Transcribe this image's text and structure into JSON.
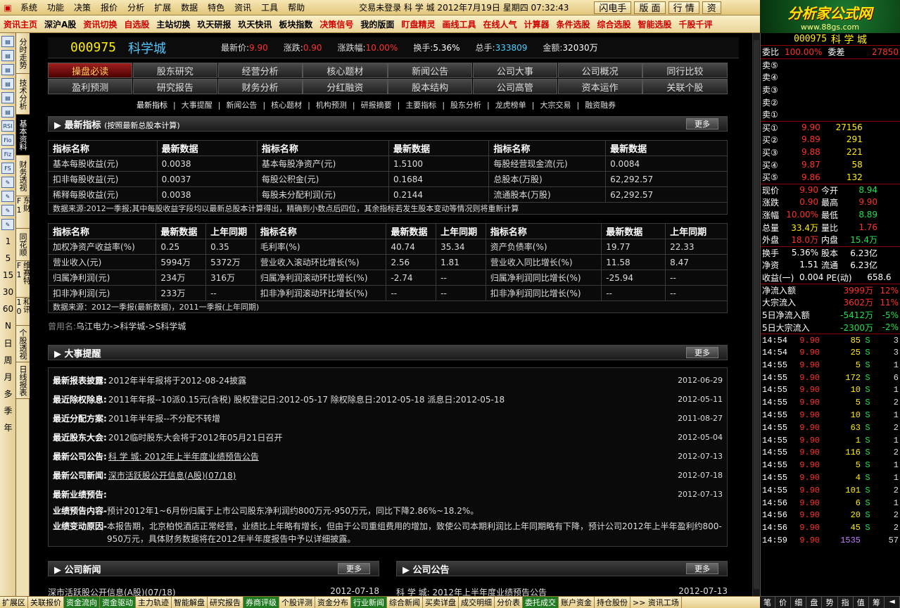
{
  "menu": {
    "items": [
      "系统",
      "功能",
      "决策",
      "报价",
      "分析",
      "扩展",
      "数据",
      "特色",
      "资讯",
      "工具",
      "帮助"
    ],
    "status": "交易未登录  科 学 城  2012年7月19日 星期四  07:32:43",
    "buttons": [
      "闪电手",
      "版 面",
      "行 情",
      "资"
    ]
  },
  "brand": {
    "title": "分析家公式网",
    "url": "www.88gs.com"
  },
  "toolbar": {
    "items": [
      {
        "label": "资讯主页",
        "color": "#d00000"
      },
      {
        "label": "深沪A股",
        "color": "#000000"
      },
      {
        "label": "资讯切换",
        "color": "#d00000"
      },
      {
        "label": "自选股",
        "color": "#d00000"
      },
      {
        "label": "主站切换",
        "color": "#000000"
      },
      {
        "label": "玖天研报",
        "color": "#000000"
      },
      {
        "label": "玖天快讯",
        "color": "#000000"
      },
      {
        "label": "板块指数",
        "color": "#000000"
      },
      {
        "label": "决策信号",
        "color": "#d00000"
      },
      {
        "label": "我的版面",
        "color": "#000000"
      },
      {
        "label": "盯盘精灵",
        "color": "#d00000"
      },
      {
        "label": "画线工具",
        "color": "#d00000"
      },
      {
        "label": "在线人气",
        "color": "#d00000"
      },
      {
        "label": "计算器",
        "color": "#d00000"
      },
      {
        "label": "条件选股",
        "color": "#d00000"
      },
      {
        "label": "综合选股",
        "color": "#d00000"
      },
      {
        "label": "智能选股",
        "color": "#d00000"
      },
      {
        "label": "千股千评",
        "color": "#d00000"
      }
    ]
  },
  "left_icons": [
    "RSI",
    "Fio",
    "Fiz",
    "FS"
  ],
  "left_periods": [
    "1",
    "5",
    "15",
    "30",
    "60",
    "N",
    "日",
    "周",
    "月",
    "多",
    "季",
    "年"
  ],
  "vtabs": [
    "分时走势",
    "技术分析",
    "基本资料",
    "财务透视",
    "东财F1",
    "同花顺",
    "维赛特F1",
    "和讯10",
    "个股透视",
    "日线报表"
  ],
  "header": {
    "code": "000975",
    "name": "科学城",
    "quotes": [
      {
        "label": "最新价:",
        "value": "9.90",
        "color": "red"
      },
      {
        "label": "涨跌:",
        "value": "0.90",
        "color": "red"
      },
      {
        "label": "涨跌幅:",
        "value": "10.00%",
        "color": "red"
      },
      {
        "label": "换手:",
        "value": "5.36%",
        "color": "white"
      },
      {
        "label": "总手:",
        "value": "333809",
        "color": "cyan"
      },
      {
        "label": "金额:",
        "value": "32030万",
        "color": "white"
      }
    ]
  },
  "nav": {
    "row1": [
      "操盘必读",
      "股东研究",
      "经营分析",
      "核心题材",
      "新闻公告",
      "公司大事",
      "公司概况",
      "同行比较"
    ],
    "row2": [
      "盈利预测",
      "研究报告",
      "财务分析",
      "分红融资",
      "股本结构",
      "公司高管",
      "资本运作",
      "关联个股"
    ],
    "active": "操盘必读"
  },
  "subnav": [
    "最新指标",
    "大事提醒",
    "新闻公告",
    "核心题材",
    "机构预测",
    "研报摘要",
    "主要指标",
    "股东分析",
    "龙虎榜单",
    "大宗交易",
    "融资融券"
  ],
  "latest": {
    "title": "最新指标",
    "subtitle": "(按照最新总股本计算)",
    "more": "更多",
    "headers": [
      "指标名称",
      "最新数据",
      "指标名称",
      "最新数据",
      "指标名称",
      "最新数据"
    ],
    "rows": [
      [
        "基本每股收益(元)",
        "0.0038",
        "基本每股净资产(元)",
        "1.5100",
        "每股经营现金流(元)",
        "0.0084"
      ],
      [
        "扣非每股收益(元)",
        "0.0037",
        "每股公积金(元)",
        "0.1684",
        "总股本(万股)",
        "62,292.57"
      ],
      [
        "稀释每股收益(元)",
        "0.0038",
        "每股未分配利润(元)",
        "0.2144",
        "流通股本(万股)",
        "62,292.57"
      ]
    ],
    "note": "数据来源:2012一季报;其中每股收益字段均以最新总股本计算得出，精确到小数点后四位，其余指标若发生股本变动等情况则将重新计算"
  },
  "growth": {
    "headers": [
      "指标名称",
      "最新数据",
      "上年同期",
      "指标名称",
      "最新数据",
      "上年同期",
      "指标名称",
      "最新数据",
      "上年同期"
    ],
    "rows": [
      [
        "加权净资产收益率(%)",
        "0.25",
        "0.35",
        "毛利率(%)",
        "40.74",
        "35.34",
        "资产负债率(%)",
        "19.77",
        "22.33"
      ],
      [
        "营业收入(元)",
        "5994万",
        "5372万",
        "营业收入滚动环比增长(%)",
        "2.56",
        "1.81",
        "营业收入同比增长(%)",
        "11.58",
        "8.47"
      ],
      [
        "归属净利润(元)",
        "234万",
        "316万",
        "归属净利润滚动环比增长(%)",
        "-2.74",
        "--",
        "归属净利润同比增长(%)",
        "-25.94",
        "--"
      ],
      [
        "扣非净利润(元)",
        "233万",
        "--",
        "扣非净利润滚动环比增长(%)",
        "--",
        "--",
        "扣非净利润同比增长(%)",
        "--",
        "--"
      ]
    ],
    "note": "数据来源：2012一季报(最新数据)，2011一季报(上年同期)"
  },
  "oldname": {
    "label": "曾用名:",
    "value": "乌江电力->科学城->S科学城"
  },
  "events": {
    "title": "大事提醒",
    "more": "更多",
    "rows": [
      {
        "label": "最新报表披露:",
        "value": "2012年半年报将于2012-08-24披露",
        "date": "2012-06-29",
        "link": false
      },
      {
        "label": "最近除权除息:",
        "value": "2011年年报--10派0.15元(含税) 股权登记日:2012-05-17 除权除息日:2012-05-18 派息日:2012-05-18",
        "date": "2012-05-11",
        "link": false
      },
      {
        "label": "最近分配方案:",
        "value": "2011年半年报--不分配不转增",
        "date": "2011-08-27",
        "link": false
      },
      {
        "label": "最近股东大会:",
        "value": "2012临时股东大会将于2012年05月21日召开",
        "date": "2012-05-04",
        "link": false
      },
      {
        "label": "最新公司公告:",
        "value": "科 学 城: 2012年上半年度业绩预告公告",
        "date": "2012-07-13",
        "link": true
      },
      {
        "label": "最新公司新闻:",
        "value": "深市活跃股公开信息(A股)(07/18)",
        "date": "2012-07-18",
        "link": true
      },
      {
        "label": "最新业绩预告:",
        "value": "",
        "date": "2012-07-13",
        "link": false
      }
    ],
    "forecast_label": "业绩预告内容-",
    "forecast": "预计2012年1~6月份归属于上市公司股东净利润约800万元-950万元，同比下降2.86%~18.2%。",
    "reason_label": "业绩变动原因-",
    "reason": "本报告期，北京柏悦酒店正常经营，业绩比上年略有增长，但由于公司重组费用的增加，致使公司本期利润比上年同期略有下降，预计公司2012年上半年盈利约800-950万元，具体财务数据将在2012年半年度报告中予以详细披露。"
  },
  "news": {
    "title": "公司新闻",
    "more": "更多",
    "first": "深市活跃股公开信息(A股)(07/18)",
    "date": "2012-07-18"
  },
  "notice": {
    "title": "公司公告",
    "more": "更多",
    "first": "科 学 城: 2012年上半年度业绩预告公告",
    "date": "2012-07-13"
  },
  "right": {
    "code": "000975",
    "name": "科 学 城",
    "wb": {
      "label": "委比",
      "value": "100.00%",
      "diff_label": "委差",
      "diff": "27850"
    },
    "sells": [
      "卖⑤",
      "卖④",
      "卖③",
      "卖②",
      "卖①"
    ],
    "buys": [
      {
        "l": "买①",
        "p": "9.90",
        "v": "27156"
      },
      {
        "l": "买②",
        "p": "9.89",
        "v": "291"
      },
      {
        "l": "买③",
        "p": "9.88",
        "v": "221"
      },
      {
        "l": "买④",
        "p": "9.87",
        "v": "58"
      },
      {
        "l": "买⑤",
        "p": "9.86",
        "v": "132"
      }
    ],
    "stats": [
      [
        {
          "l": "现价",
          "v": "9.90",
          "c": "red"
        },
        {
          "l": "今开",
          "v": "8.94",
          "c": "green"
        }
      ],
      [
        {
          "l": "涨跌",
          "v": "0.90",
          "c": "red"
        },
        {
          "l": "最高",
          "v": "9.90",
          "c": "red"
        }
      ],
      [
        {
          "l": "涨幅",
          "v": "10.00%",
          "c": "red"
        },
        {
          "l": "最低",
          "v": "8.89",
          "c": "green"
        }
      ],
      [
        {
          "l": "总量",
          "v": "33.4万",
          "c": "yellow"
        },
        {
          "l": "量比",
          "v": "1.76",
          "c": "red"
        }
      ],
      [
        {
          "l": "外盘",
          "v": "18.0万",
          "c": "red"
        },
        {
          "l": "内盘",
          "v": "15.4万",
          "c": "green"
        }
      ]
    ],
    "stats2": [
      [
        {
          "l": "换手",
          "v": "5.36%",
          "c": "white"
        },
        {
          "l": "股本",
          "v": "6.23亿",
          "c": "white"
        }
      ],
      [
        {
          "l": "净资",
          "v": "1.51",
          "c": "white"
        },
        {
          "l": "流通",
          "v": "6.23亿",
          "c": "white"
        }
      ],
      [
        {
          "l": "收益(一)",
          "v": "0.004",
          "c": "white"
        },
        {
          "l": "PE(动)",
          "v": "658.6",
          "c": "white"
        }
      ]
    ],
    "flows": [
      {
        "l": "净流入额",
        "v": "3999万",
        "p": "12%",
        "c": "red"
      },
      {
        "l": "大宗流入",
        "v": "3602万",
        "p": "11%",
        "c": "red"
      },
      {
        "l": "5日净流入额",
        "v": "-5412万",
        "p": "-5%",
        "c": "green"
      },
      {
        "l": "5日大宗流入",
        "v": "-2300万",
        "p": "-2%",
        "c": "green"
      }
    ],
    "ticks": [
      [
        "14:54",
        "9.90",
        "85",
        "S",
        "3"
      ],
      [
        "14:54",
        "9.90",
        "25",
        "S",
        "3"
      ],
      [
        "14:55",
        "9.90",
        "5",
        "S",
        "1"
      ],
      [
        "14:55",
        "9.90",
        "172",
        "S",
        "6"
      ],
      [
        "14:55",
        "9.90",
        "10",
        "S",
        "1"
      ],
      [
        "14:55",
        "9.90",
        "5",
        "S",
        "2"
      ],
      [
        "14:55",
        "9.90",
        "10",
        "S",
        "1"
      ],
      [
        "14:55",
        "9.90",
        "63",
        "S",
        "2"
      ],
      [
        "14:55",
        "9.90",
        "1",
        "S",
        "1"
      ],
      [
        "14:55",
        "9.90",
        "116",
        "S",
        "2"
      ],
      [
        "14:55",
        "9.90",
        "5",
        "S",
        "1"
      ],
      [
        "14:55",
        "9.90",
        "4",
        "S",
        "1"
      ],
      [
        "14:55",
        "9.90",
        "101",
        "S",
        "2"
      ],
      [
        "14:56",
        "9.90",
        "6",
        "S",
        "1"
      ],
      [
        "14:56",
        "9.90",
        "20",
        "S",
        "2"
      ],
      [
        "14:56",
        "9.90",
        "45",
        "S",
        "2"
      ],
      [
        "14:59",
        "9.90",
        "1535",
        "",
        "57"
      ]
    ],
    "bottom_tabs": [
      "笔",
      "价",
      "细",
      "盘",
      "势",
      "指",
      "值",
      "筹",
      "◄"
    ]
  },
  "statusbar": [
    "扩展区",
    "关联报价",
    "资金流向",
    "资金驱动",
    "主力轨迹",
    "智能解盘",
    "研究报告",
    "券商评级",
    "个股评测",
    "资金分布",
    "行业新闻",
    "综合新闻",
    "买卖详盘",
    "成交明细",
    "分价表",
    "委托成交",
    "账户资金",
    "持仓股份",
    ">> 资讯工场"
  ]
}
